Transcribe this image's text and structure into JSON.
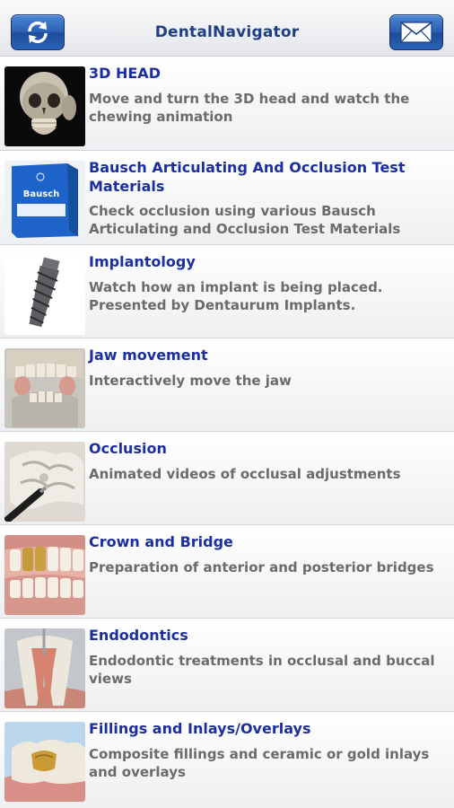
{
  "header": {
    "title": "DentalNavigator",
    "left_icon": "refresh-icon",
    "right_icon": "mail-icon"
  },
  "items": [
    {
      "title": "3D HEAD",
      "description": "Move and turn the 3D head and watch the chewing animation"
    },
    {
      "title": "Bausch Articulating And Occlusion Test Materials",
      "description": "Check occlusion using various Bausch Articulating and Occlusion Test Materials",
      "thumb_text": "Bausch"
    },
    {
      "title": "Implantology",
      "description": "Watch how an implant is being placed. Presented by Dentaurum Implants."
    },
    {
      "title": "Jaw movement",
      "description": "Interactively move the jaw"
    },
    {
      "title": "Occlusion",
      "description": "Animated videos of occlusal adjustments"
    },
    {
      "title": "Crown and Bridge",
      "description": "Preparation of anterior and posterior bridges"
    },
    {
      "title": "Endodontics",
      "description": "Endodontic treatments in occlusal and buccal views"
    },
    {
      "title": "Fillings and Inlays/Overlays",
      "description": "Composite fillings and ceramic or gold inlays and overlays"
    }
  ],
  "colors": {
    "title_blue": "#1b2f9e",
    "header_title": "#1f3f84",
    "desc_gray": "#6b6b6b",
    "button_blue": "#2a5fb2"
  }
}
